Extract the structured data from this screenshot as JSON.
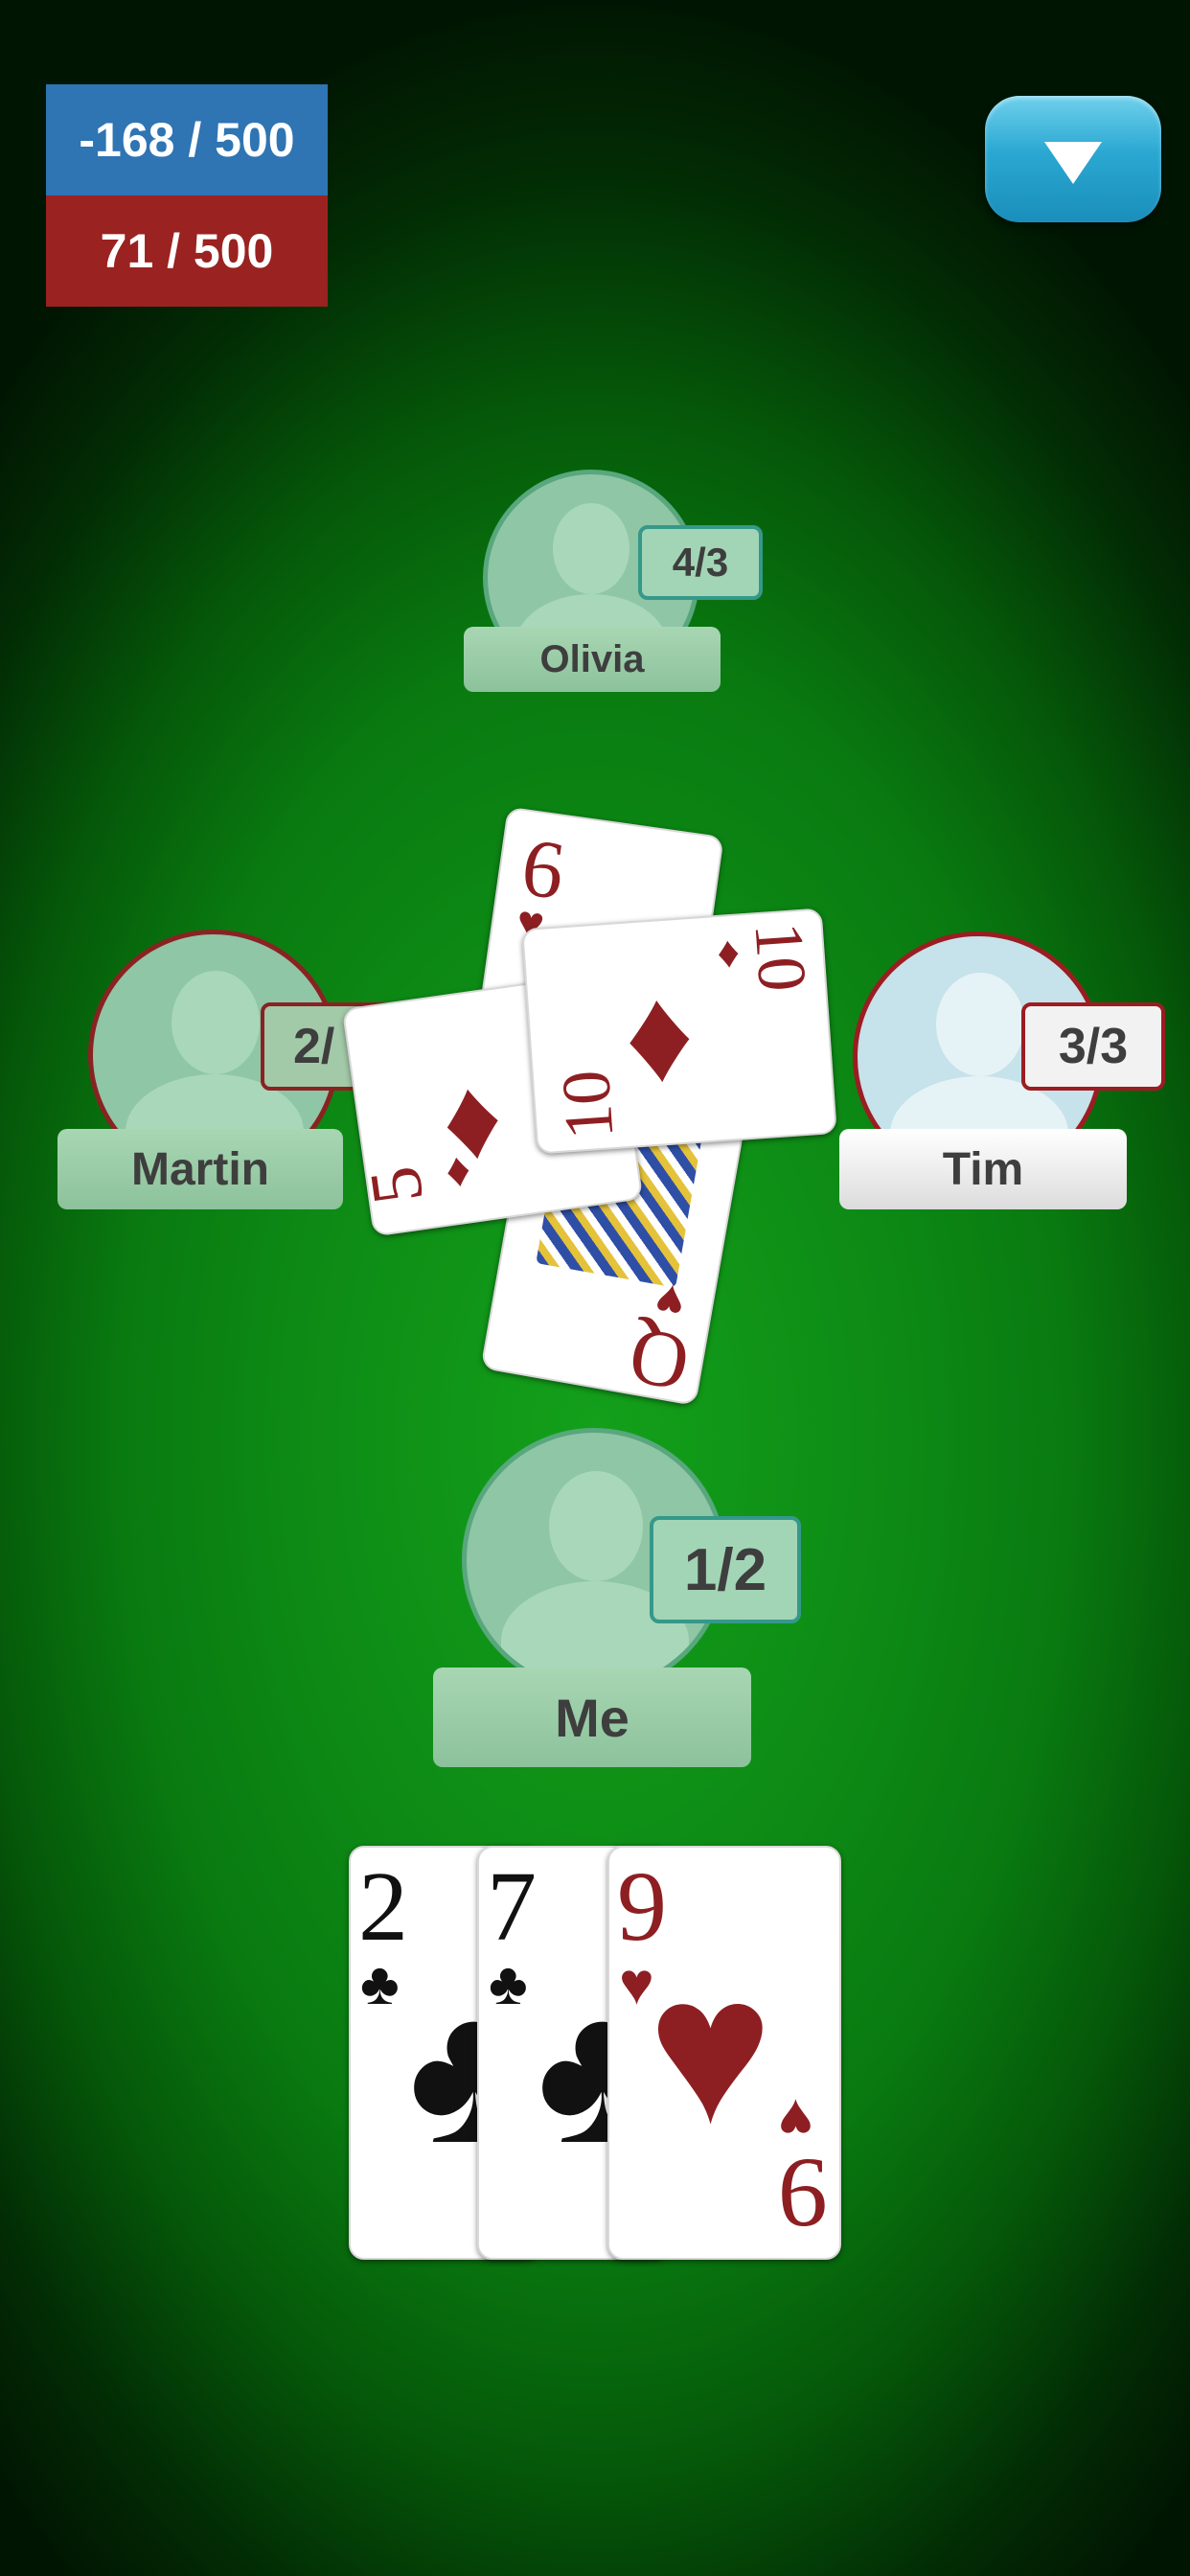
{
  "scores": {
    "team1": "-168 / 500",
    "team2": "71 / 500"
  },
  "menu": {
    "icon": "triangle-down-icon"
  },
  "players": {
    "top": {
      "name": "Olivia",
      "bid": "4/3"
    },
    "left": {
      "name": "Martin",
      "bid": "2/"
    },
    "right": {
      "name": "Tim",
      "bid": "3/3"
    },
    "me": {
      "name": "Me",
      "bid": "1/2"
    }
  },
  "trick": [
    {
      "rank": "6",
      "suit": "♥",
      "color": "#8d1f22"
    },
    {
      "rank": "10",
      "suit": "♦",
      "color": "#8d1f22"
    },
    {
      "rank": "5",
      "suit": "♦",
      "color": "#8d1f22"
    },
    {
      "rank": "Q",
      "suit": "♥",
      "color": "#8d1f22"
    }
  ],
  "hand": [
    {
      "rank": "2",
      "suit": "♣",
      "color": "#111111"
    },
    {
      "rank": "7",
      "suit": "♣",
      "color": "#111111"
    },
    {
      "rank": "9",
      "suit": "♥",
      "color": "#8d1f22"
    }
  ],
  "colors": {
    "team1": "#2f74b3",
    "team2": "#9a2220",
    "table": "#0d8a15"
  }
}
